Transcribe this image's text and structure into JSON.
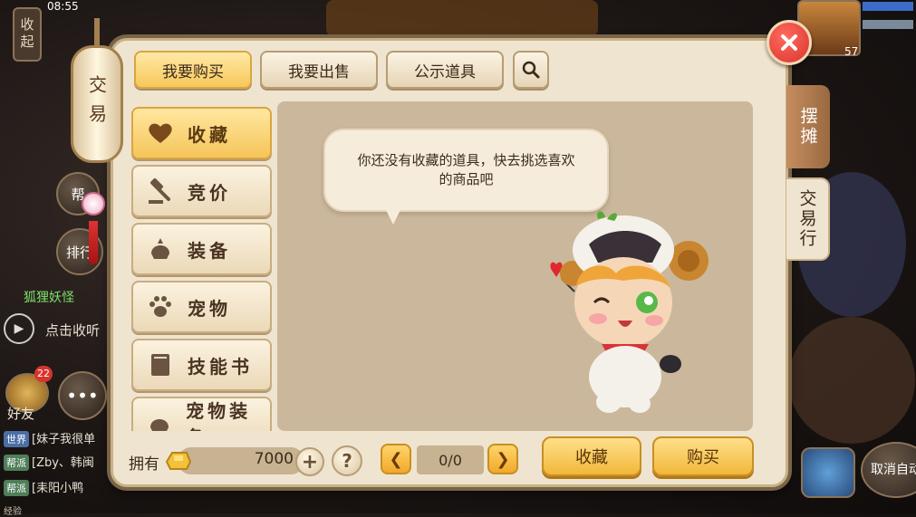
{
  "status": {
    "time": "08:55",
    "collapse_label": "收起"
  },
  "hud": {
    "level": "57"
  },
  "left_hud": {
    "help_label": "帮",
    "rank_label": "排行",
    "pet_name": "狐狸妖怪",
    "voice_hint": "点击收听",
    "friends_label": "好友",
    "friends_badge": "22",
    "chat": [
      {
        "tag": "世界",
        "text": "[妹子我很单"
      },
      {
        "tag": "帮派",
        "text": "[Zby、韩闽"
      },
      {
        "tag": "帮派",
        "text": "[耒阳小鸭"
      }
    ],
    "bottom_label": "经验"
  },
  "right_hud": {
    "auto_label": "取消自动"
  },
  "panel": {
    "lantern_title": "交易",
    "tabs": [
      "我要购买",
      "我要出售",
      "公示道具"
    ],
    "side_tabs": [
      "摆摊",
      "交易行"
    ],
    "categories": [
      {
        "label": "收藏",
        "icon": "heart-icon"
      },
      {
        "label": "竞价",
        "icon": "gavel-icon"
      },
      {
        "label": "装备",
        "icon": "helmet-icon"
      },
      {
        "label": "宠物",
        "icon": "paw-icon"
      },
      {
        "label": "技能书",
        "icon": "book-icon"
      },
      {
        "label": "宠物装备",
        "icon": "pet-gear-icon"
      }
    ],
    "empty_message": "你还没有收藏的道具，快去挑选喜欢的商品吧",
    "owned_label": "拥有",
    "gold_amount": "7000",
    "page_indicator": "0/0",
    "favorite_button": "收藏",
    "buy_button": "购买"
  },
  "colors": {
    "panel_bg": "#efe4cf",
    "content_bg": "#cbb89c",
    "accent_gold": "#f2b73a",
    "close_red": "#d8342c"
  }
}
